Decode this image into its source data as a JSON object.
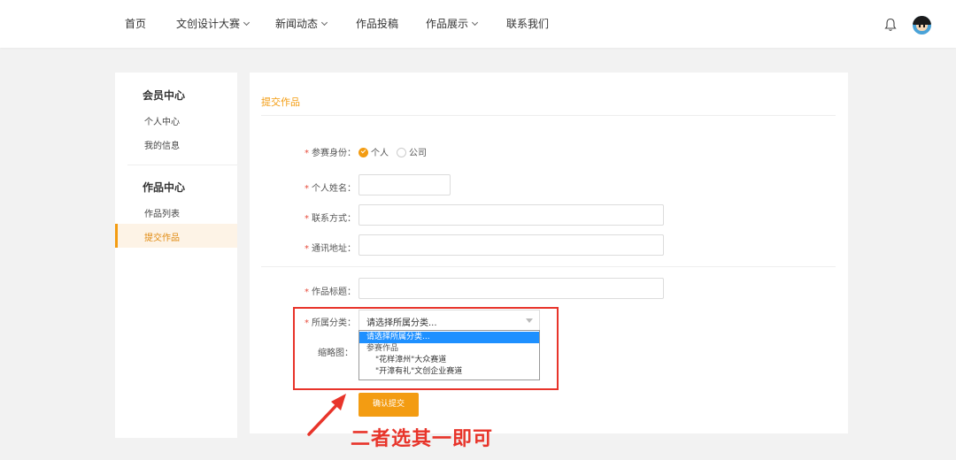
{
  "nav": {
    "items": [
      {
        "label": "首页",
        "dropdown": false
      },
      {
        "label": "文创设计大赛",
        "dropdown": true
      },
      {
        "label": "新闻动态",
        "dropdown": true
      },
      {
        "label": "作品投稿",
        "dropdown": false
      },
      {
        "label": "作品展示",
        "dropdown": true
      },
      {
        "label": "联系我们",
        "dropdown": false
      }
    ],
    "bell_icon": "bell-icon",
    "avatar_icon": "user-avatar"
  },
  "sidebar": {
    "groups": [
      {
        "title": "会员中心",
        "items": [
          "个人中心",
          "我的信息"
        ]
      },
      {
        "title": "作品中心",
        "items": [
          "作品列表",
          "提交作品"
        ]
      }
    ],
    "active_item": "提交作品"
  },
  "form": {
    "title": "提交作品",
    "identity": {
      "label": "参赛身份：",
      "required": true,
      "options": [
        "个人",
        "公司"
      ],
      "selected": "个人"
    },
    "name": {
      "label": "个人姓名：",
      "required": true,
      "value": ""
    },
    "contact": {
      "label": "联系方式：",
      "required": true,
      "value": ""
    },
    "address": {
      "label": "通讯地址：",
      "required": true,
      "value": ""
    },
    "work_title": {
      "label": "作品标题：",
      "required": true,
      "value": ""
    },
    "category": {
      "label": "所属分类：",
      "required": true,
      "selected": "请选择所属分类...",
      "options": [
        {
          "label": "请选择所属分类...",
          "kind": "selected"
        },
        {
          "label": "参赛作品",
          "kind": "group"
        },
        {
          "label": "\"花样漳州\"大众赛道",
          "kind": "child"
        },
        {
          "label": "\"开漳有礼\"文创企业赛道",
          "kind": "child"
        }
      ]
    },
    "thumbnail": {
      "label": "缩略图："
    },
    "submit_label": "确认提交"
  },
  "annotation": {
    "text": "二者选其一即可",
    "color": "#e8342a"
  },
  "colors": {
    "accent": "#f39c12",
    "highlight": "#1e90ff",
    "required": "#e74c3c"
  }
}
